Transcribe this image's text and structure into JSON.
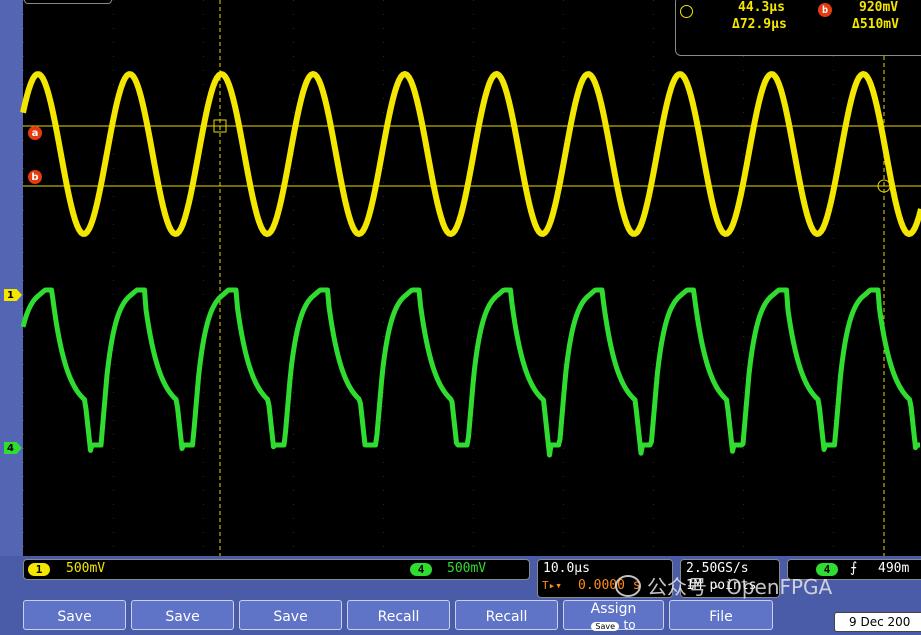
{
  "cursor_readout": {
    "a_time": "44.3µs",
    "delta_time": "Δ72.9µs",
    "b_marker": "b",
    "b_level": "920mV",
    "delta_level": "Δ510mV"
  },
  "markers": {
    "a": "a",
    "b": "b"
  },
  "channels": {
    "ch1": {
      "label": "1",
      "scale": "500mV",
      "color": "#f3e600"
    },
    "ch4": {
      "label": "4",
      "scale": "500mV",
      "color": "#2fdc2f"
    }
  },
  "timebase": {
    "scale": "10.0µs",
    "trigger_pos": "0.0000 s"
  },
  "acquisition": {
    "rate": "2.50GS/s",
    "points": "1M points"
  },
  "trigger": {
    "channel": "4",
    "slope_icon": "rising-edge-icon",
    "level": "490m"
  },
  "softkeys": [
    {
      "label": "Save"
    },
    {
      "label": "Save"
    },
    {
      "label": "Save"
    },
    {
      "label": "Recall"
    },
    {
      "label": "Recall"
    },
    {
      "label": "Assign",
      "sub_tag": "Save",
      "sub_text": "to"
    },
    {
      "label": "File"
    }
  ],
  "date": "9 Dec 200",
  "watermark": "公众号 · OpenFPGA"
}
